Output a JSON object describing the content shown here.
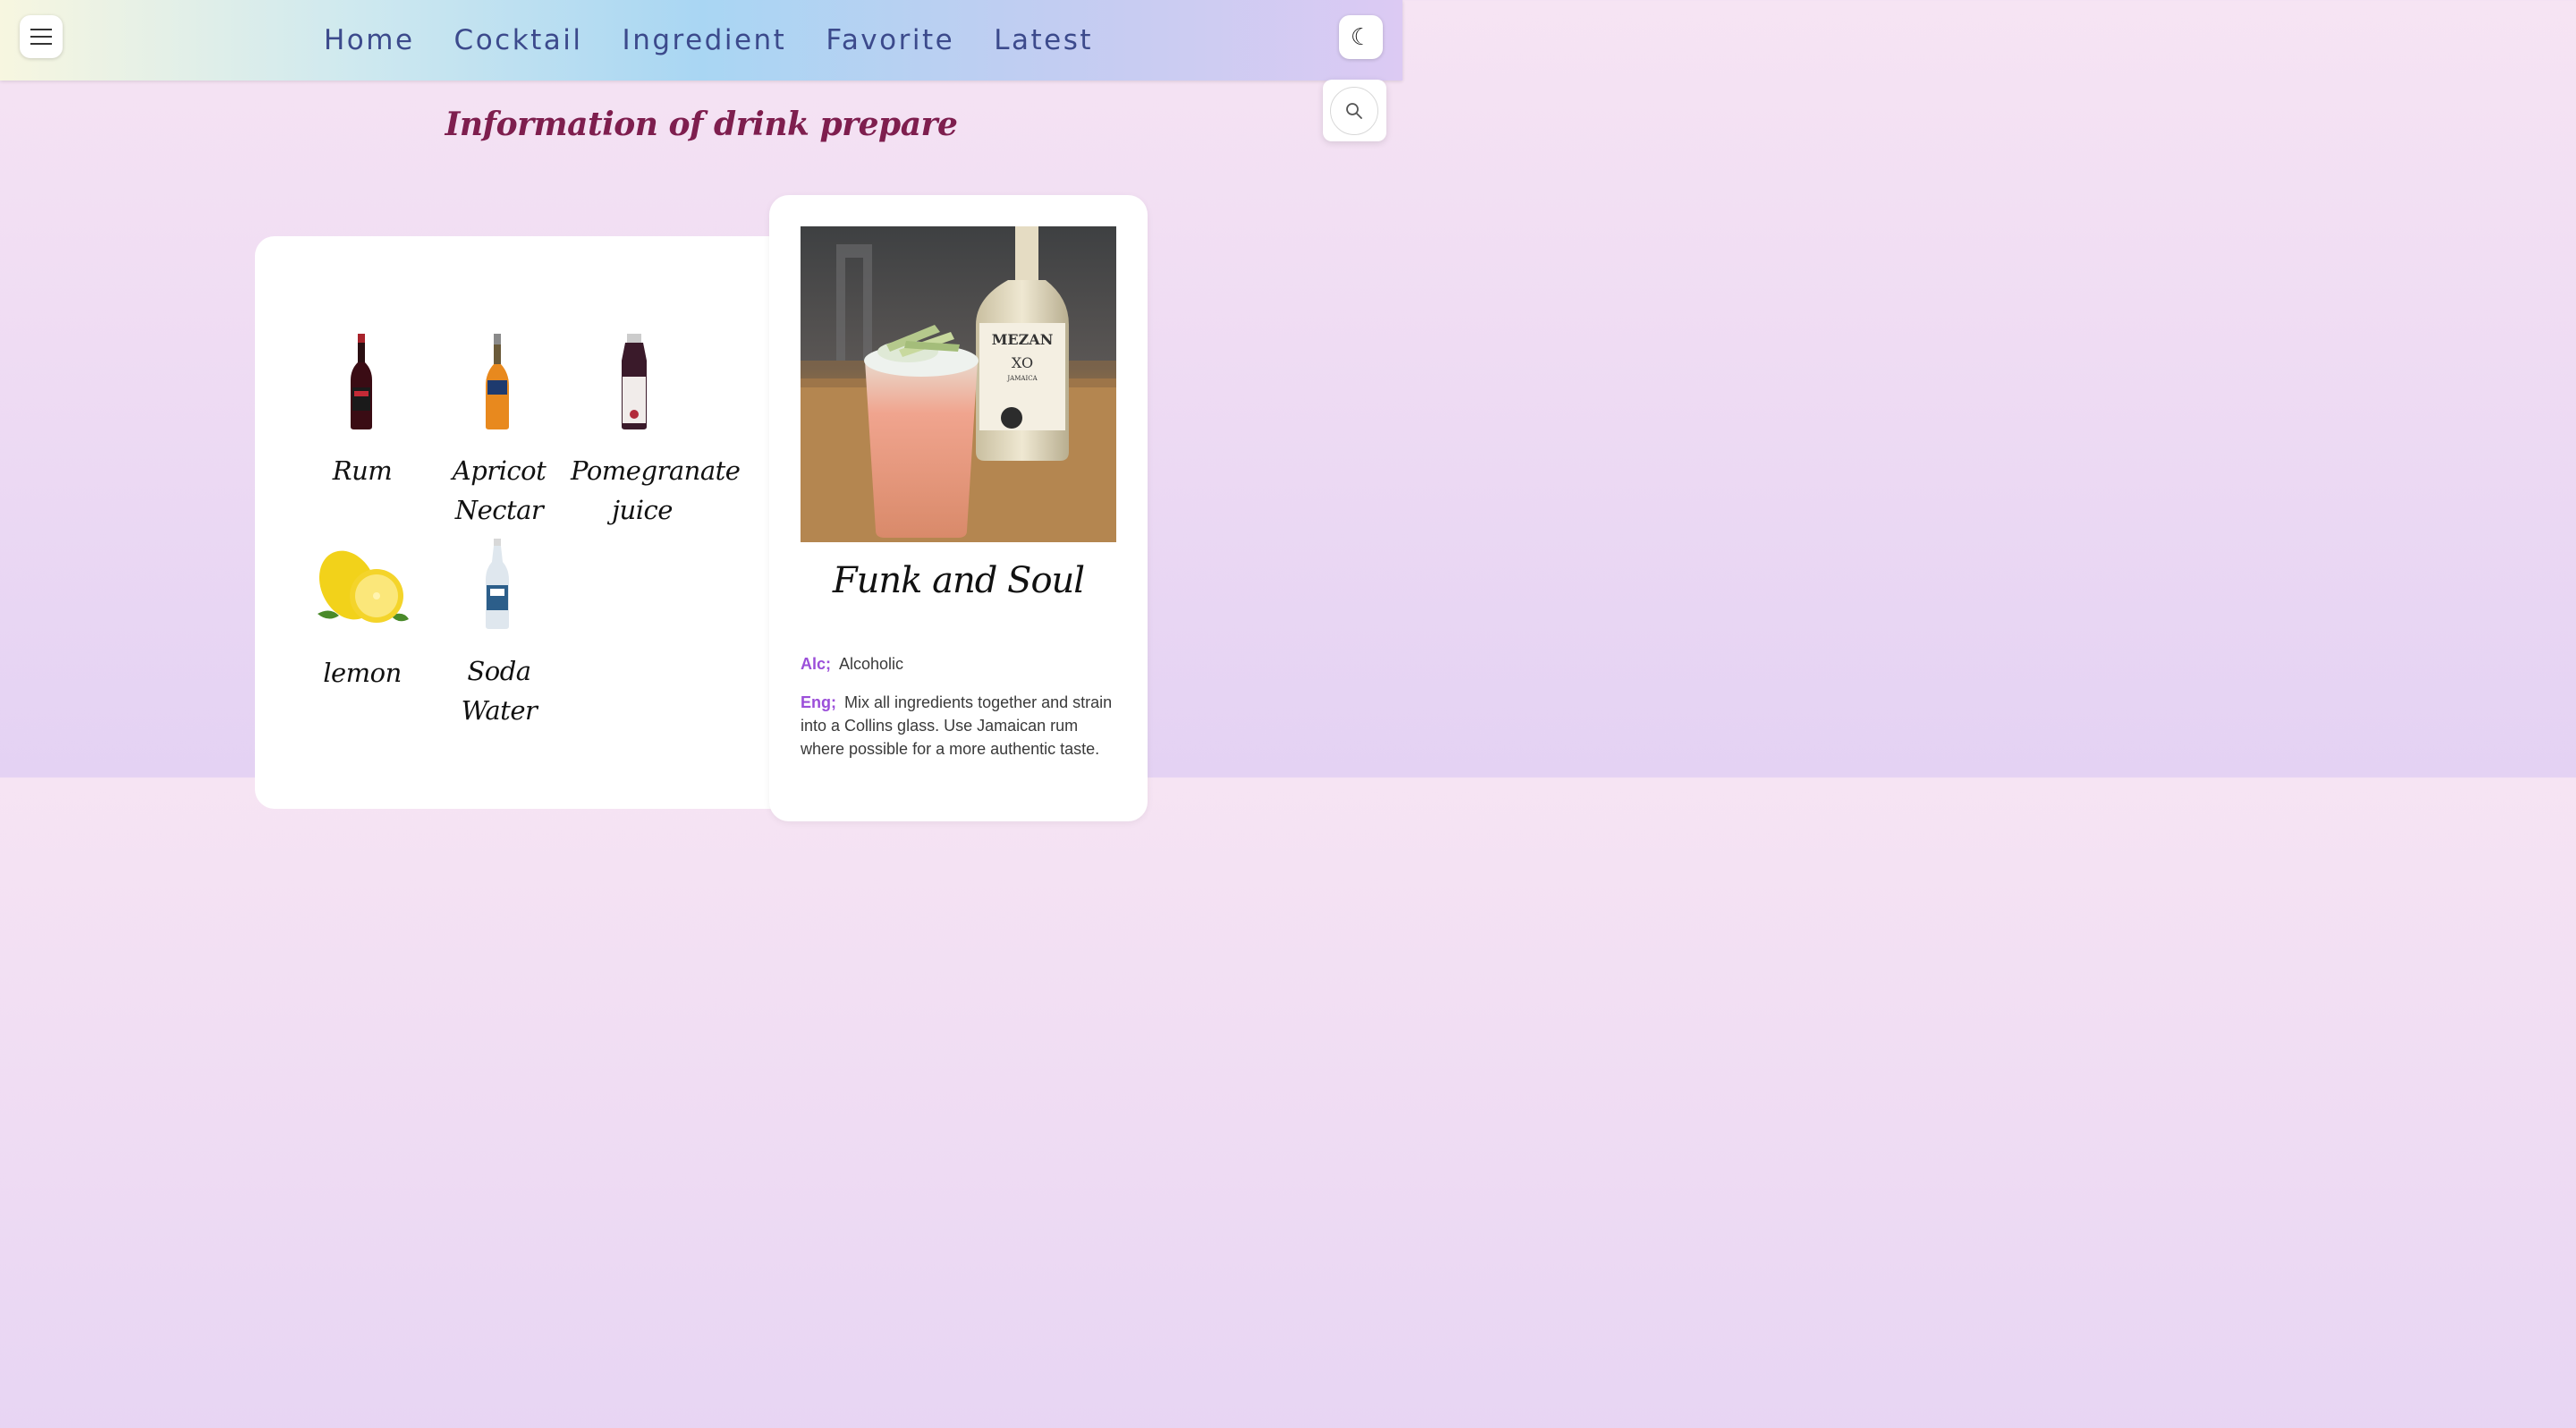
{
  "header": {
    "menu_icon": "hamburger-menu-icon",
    "nav": [
      "Home",
      "Cocktail",
      "Ingredient",
      "Favorite",
      "Latest"
    ],
    "theme_icon": "crescent-moon-icon",
    "theme_glyph": "☾",
    "search_icon": "search-icon"
  },
  "page": {
    "title": "Information of drink prepare"
  },
  "ingredients": [
    {
      "name": "Rum",
      "icon": "rum-bottle-image"
    },
    {
      "name": "Apricot Nectar",
      "icon": "apricot-nectar-bottle-image"
    },
    {
      "name": "Pomegranate juice",
      "icon": "pomegranate-juice-bottle-image"
    },
    {
      "name": "lemon",
      "icon": "lemon-image"
    },
    {
      "name": "Soda Water",
      "icon": "soda-water-bottle-image"
    }
  ],
  "drink": {
    "name": "Funk and Soul",
    "photo": "cocktail-photo",
    "bottle_label": [
      "MEZAN",
      "XO",
      "JAMAICA"
    ],
    "alc_key": "Alc;",
    "alc_value": "Alcoholic",
    "eng_key": "Eng;",
    "instructions": "Mix all ingredients together and strain into a Collins glass. Use Jamaican rum where possible for a more authentic taste."
  },
  "colors": {
    "nav_text": "#3c4a8c",
    "title": "#7e1e4e",
    "key_accent": "#9b4fd9"
  }
}
